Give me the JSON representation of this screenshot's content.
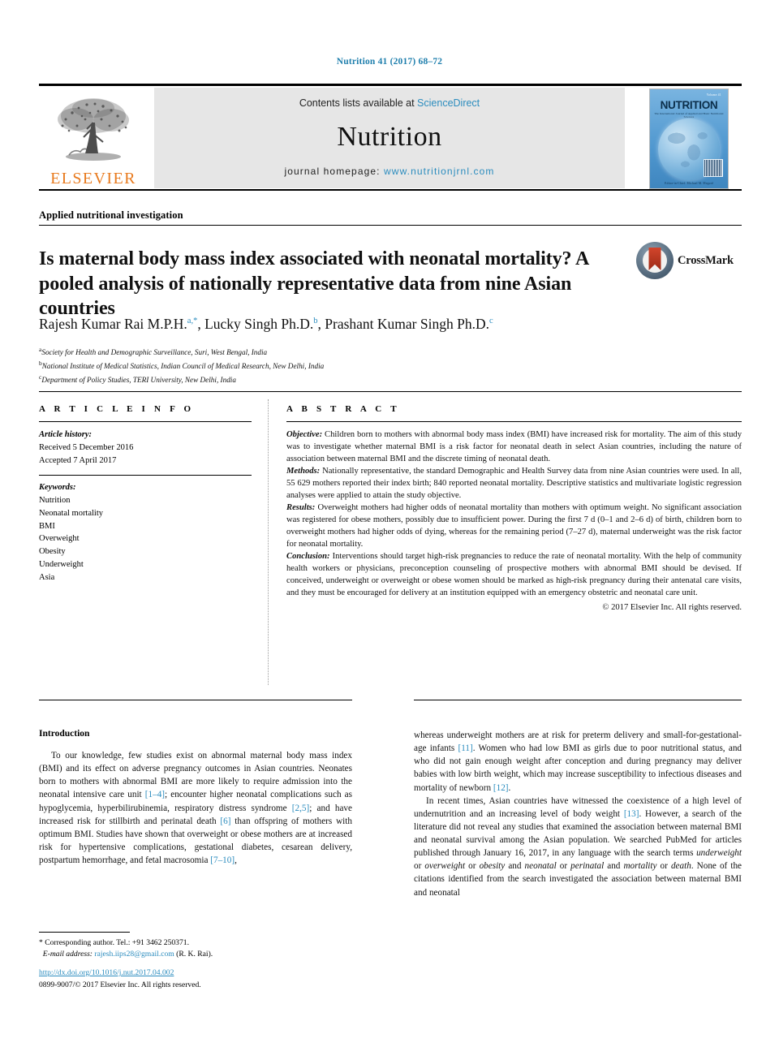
{
  "running_head": "Nutrition 41 (2017) 68–72",
  "masthead": {
    "publisher_name": "ELSEVIER",
    "contents_prefix": "Contents lists available at ",
    "contents_link": "ScienceDirect",
    "journal_name": "Nutrition",
    "homepage_prefix": "journal homepage: ",
    "homepage_url": "www.nutritionjrnl.com",
    "cover": {
      "volume": "Volume 41",
      "title": "NUTRITION",
      "subtitle": "The International Journal of Applied and Basic Nutritional Sciences",
      "footer": "Editor-in-Chief: Michael M. Meguid"
    }
  },
  "article": {
    "kicker": "Applied nutritional investigation",
    "title": "Is maternal body mass index associated with neonatal mortality? A pooled analysis of nationally representative data from nine Asian countries",
    "crossmark_label": "CrossMark",
    "authors_html": "Rajesh Kumar Rai M.P.H.<sup>a,*</sup>, Lucky Singh Ph.D.<sup>b</sup>, Prashant Kumar Singh Ph.D.<sup>c</sup>",
    "affiliations": [
      {
        "marker": "a",
        "text": "Society for Health and Demographic Surveillance, Suri, West Bengal, India"
      },
      {
        "marker": "b",
        "text": "National Institute of Medical Statistics, Indian Council of Medical Research, New Delhi, India"
      },
      {
        "marker": "c",
        "text": "Department of Policy Studies, TERI University, New Delhi, India"
      }
    ]
  },
  "article_info": {
    "heading": "A R T I C L E   I N F O",
    "history_label": "Article history:",
    "history": [
      "Received 5 December 2016",
      "Accepted 7 April 2017"
    ],
    "keywords_label": "Keywords:",
    "keywords": [
      "Nutrition",
      "Neonatal mortality",
      "BMI",
      "Overweight",
      "Obesity",
      "Underweight",
      "Asia"
    ]
  },
  "abstract": {
    "heading": "A B S T R A C T",
    "sections": [
      {
        "label": "Objective:",
        "text": " Children born to mothers with abnormal body mass index (BMI) have increased risk for mortality. The aim of this study was to investigate whether maternal BMI is a risk factor for neonatal death in select Asian countries, including the nature of association between maternal BMI and the discrete timing of neonatal death."
      },
      {
        "label": "Methods:",
        "text": " Nationally representative, the standard Demographic and Health Survey data from nine Asian countries were used. In all, 55 629 mothers reported their index birth; 840 reported neonatal mortality. Descriptive statistics and multivariate logistic regression analyses were applied to attain the study objective."
      },
      {
        "label": "Results:",
        "text": " Overweight mothers had higher odds of neonatal mortality than mothers with optimum weight. No significant association was registered for obese mothers, possibly due to insufficient power. During the first 7 d (0–1 and 2–6 d) of birth, children born to overweight mothers had higher odds of dying, whereas for the remaining period (7–27 d), maternal underweight was the risk factor for neonatal mortality."
      },
      {
        "label": "Conclusion:",
        "text": " Interventions should target high-risk pregnancies to reduce the rate of neonatal mortality. With the help of community health workers or physicians, preconception counseling of prospective mothers with abnormal BMI should be devised. If conceived, underweight or overweight or obese women should be marked as high-risk pregnancy during their antenatal care visits, and they must be encouraged for delivery at an institution equipped with an emergency obstetric and neonatal care unit."
      }
    ],
    "copyright": "© 2017 Elsevier Inc. All rights reserved."
  },
  "body": {
    "intro_heading": "Introduction",
    "left_paragraph_html": "To our knowledge, few studies exist on abnormal maternal body mass index (BMI) and its effect on adverse pregnancy outcomes in Asian countries. Neonates born to mothers with abnormal BMI are more likely to require admission into the neonatal intensive care unit <span class=\"ref\">[1–4]</span>; encounter higher neonatal complications such as hypoglycemia, hyperbilirubinemia, respiratory distress syndrome <span class=\"ref\">[2,5]</span>; and have increased risk for stillbirth and perinatal death <span class=\"ref\">[6]</span> than offspring of mothers with optimum BMI. Studies have shown that overweight or obese mothers are at increased risk for hypertensive complications, gestational diabetes, cesarean delivery, postpartum hemorrhage, and fetal macrosomia <span class=\"ref\">[7–10]</span>,",
    "right_paragraph_1_html": "whereas underweight mothers are at risk for preterm delivery and small-for-gestational-age infants <span class=\"ref\">[11]</span>. Women who had low BMI as girls due to poor nutritional status, and who did not gain enough weight after conception and during pregnancy may deliver babies with low birth weight, which may increase susceptibility to infectious diseases and mortality of newborn <span class=\"ref\">[12]</span>.",
    "right_paragraph_2_html": "In recent times, Asian countries have witnessed the coexistence of a high level of undernutrition and an increasing level of body weight <span class=\"ref\">[13]</span>. However, a search of the literature did not reveal any studies that examined the association between maternal BMI and neonatal survival among the Asian population. We searched PubMed for articles published through January 16, 2017, in any language with the search terms <span class=\"ital\">underweight</span> or <span class=\"ital\">overweight</span> or <span class=\"ital\">obesity</span> and <span class=\"ital\">neonatal</span> or <span class=\"ital\">perinatal</span> and <span class=\"ital\">mortality</span> or <span class=\"ital\">death</span>. None of the citations identified from the search investigated the association between maternal BMI and neonatal"
  },
  "footnote": {
    "corresponding_html": "* Corresponding author. Tel.: +91 3462 250371.",
    "email_label": "E-mail address:",
    "email": "rajesh.iips28@gmail.com",
    "email_suffix": " (R. K. Rai)."
  },
  "footer": {
    "doi": "http://dx.doi.org/10.1016/j.nut.2017.04.002",
    "issn_line": "0899-9007/© 2017 Elsevier Inc. All rights reserved."
  },
  "colors": {
    "link_blue": "#2b8cbe",
    "elsevier_orange": "#e87a1e",
    "running_head_blue": "#1f7fad"
  }
}
